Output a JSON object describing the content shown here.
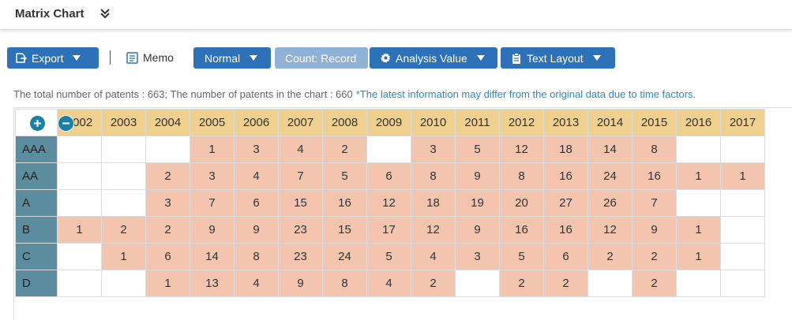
{
  "header": {
    "title": "Matrix Chart"
  },
  "toolbar": {
    "export_label": "Export",
    "memo_label": "Memo",
    "normal_label": "Normal",
    "count_label": "Count: Record",
    "analysis_label": "Analysis Value",
    "text_layout_label": "Text Layout"
  },
  "info": {
    "summary": "The total number of patents : 663; The number of patents in the chart : 660",
    "note": "*The latest information may differ from the original data due to time factors."
  },
  "matrix": {
    "years": [
      "2002",
      "2003",
      "2004",
      "2005",
      "2006",
      "2007",
      "2008",
      "2009",
      "2010",
      "2011",
      "2012",
      "2013",
      "2014",
      "2015",
      "2016",
      "2017"
    ],
    "rows": [
      {
        "label": "AAA",
        "cells": [
          "",
          "",
          "",
          "1",
          "3",
          "4",
          "2",
          "",
          "3",
          "5",
          "12",
          "18",
          "14",
          "8",
          "",
          ""
        ]
      },
      {
        "label": "AA",
        "cells": [
          "",
          "",
          "2",
          "3",
          "4",
          "7",
          "5",
          "6",
          "8",
          "9",
          "8",
          "16",
          "24",
          "16",
          "1",
          "1"
        ]
      },
      {
        "label": "A",
        "cells": [
          "",
          "",
          "3",
          "7",
          "6",
          "15",
          "16",
          "12",
          "18",
          "19",
          "20",
          "27",
          "26",
          "7",
          "",
          ""
        ]
      },
      {
        "label": "B",
        "cells": [
          "1",
          "2",
          "2",
          "9",
          "9",
          "23",
          "15",
          "17",
          "12",
          "9",
          "16",
          "16",
          "12",
          "9",
          "1",
          ""
        ]
      },
      {
        "label": "C",
        "cells": [
          "",
          "1",
          "6",
          "14",
          "8",
          "23",
          "24",
          "5",
          "4",
          "3",
          "5",
          "6",
          "2",
          "2",
          "1",
          ""
        ]
      },
      {
        "label": "D",
        "cells": [
          "",
          "",
          "1",
          "13",
          "4",
          "9",
          "8",
          "4",
          "2",
          "",
          "2",
          "2",
          "",
          "2",
          "",
          ""
        ]
      }
    ]
  },
  "colors": {
    "button": "#2d72b8",
    "button_disabled": "#8fb1d6",
    "year_header": "#efd08f",
    "row_header": "#5b8d9e",
    "filled_cell": "#f4c5ae",
    "note": "#2a8ab8"
  },
  "icons": {
    "collapse": "double-chevron-down-icon",
    "export": "export-icon",
    "memo": "memo-icon",
    "analysis": "gear-icon",
    "text_layout": "clipboard-icon",
    "zoom_in": "plus-circle-icon",
    "zoom_out": "minus-circle-icon"
  }
}
